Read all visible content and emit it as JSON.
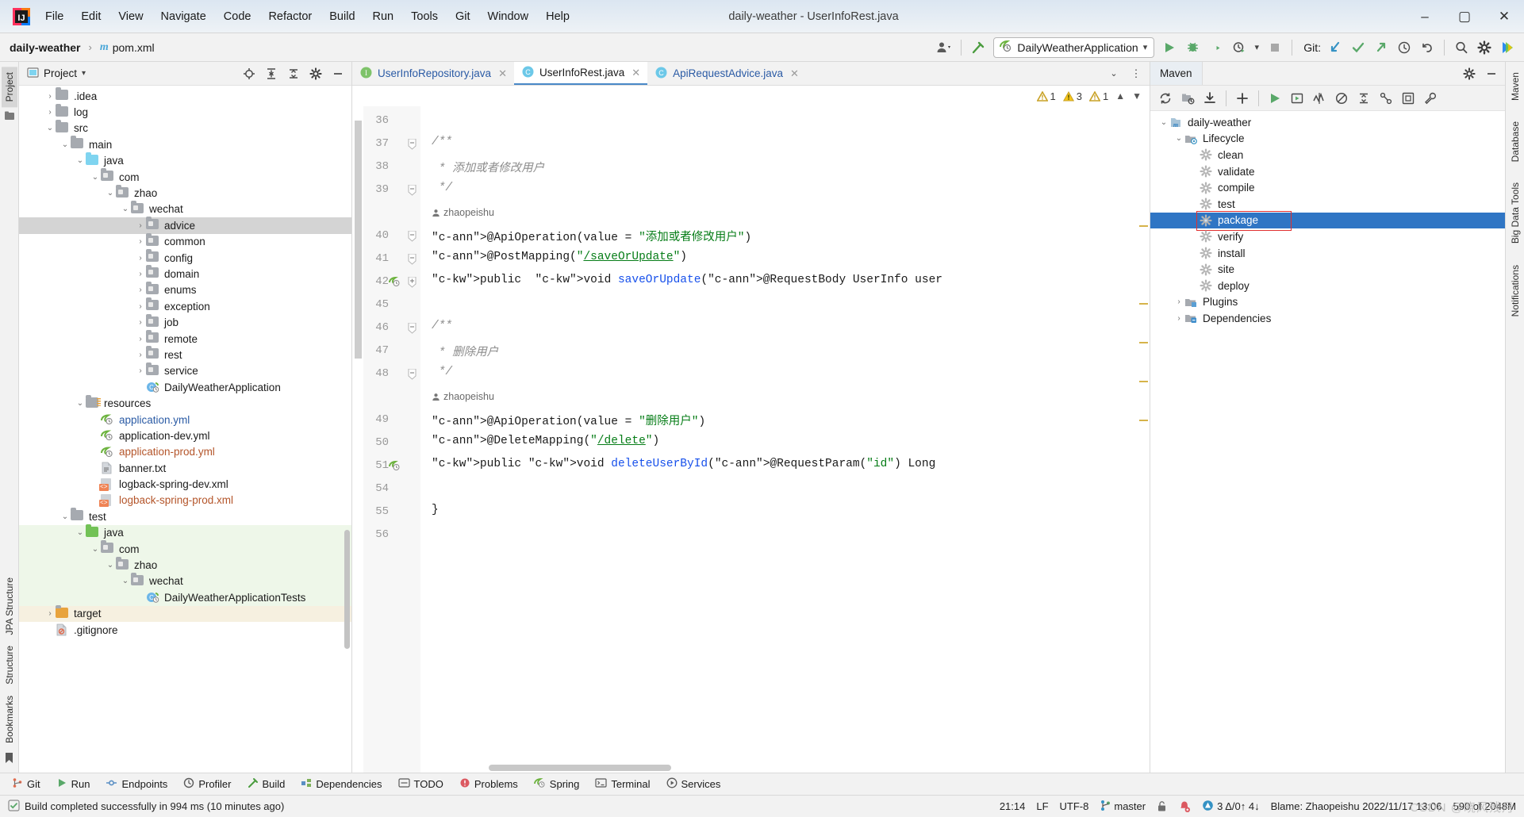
{
  "window": {
    "title": "daily-weather - UserInfoRest.java",
    "minimize": "–",
    "maximize": "▢",
    "close": "✕",
    "logo_icon": "intellij-idea-logo"
  },
  "menubar": {
    "items": [
      "File",
      "Edit",
      "View",
      "Navigate",
      "Code",
      "Refactor",
      "Build",
      "Run",
      "Tools",
      "Git",
      "Window",
      "Help"
    ]
  },
  "navbar": {
    "project": "daily-weather",
    "file": "pom.xml",
    "file_icon": "maven-m-icon",
    "separator": "›",
    "run_config": "DailyWeatherApplication",
    "run_config_icon": "spring-boot-icon",
    "dropdown_caret": "▾",
    "git_label": "Git:",
    "icons": [
      "user-avatar-icon",
      "build-hammer-icon",
      "run-icon",
      "debug-icon",
      "run-coverage-icon",
      "profiler-icon",
      "stop-icon",
      "git-update-icon",
      "git-commit-icon",
      "git-push-icon",
      "git-history-icon",
      "git-rollback-icon",
      "search-everywhere-icon",
      "settings-gear-icon",
      "ide-features-icon"
    ]
  },
  "left_strip": {
    "tabs": [
      {
        "label": "Project",
        "icon": "project-icon",
        "selected": true
      },
      {
        "label": "Bookmarks",
        "icon": "bookmark-icon",
        "selected": false
      },
      {
        "label": "Structure",
        "icon": "structure-icon",
        "selected": false
      },
      {
        "label": "JPA Structure",
        "icon": "jpa-structure-icon",
        "selected": false
      }
    ]
  },
  "right_strip": {
    "tabs": [
      {
        "label": "Maven",
        "icon": "maven-icon"
      },
      {
        "label": "Database",
        "icon": "database-icon"
      },
      {
        "label": "Big Data Tools",
        "icon": "big-data-tools-icon"
      },
      {
        "label": "Notifications",
        "icon": "notifications-icon"
      }
    ]
  },
  "project_pane": {
    "title": "Project",
    "dropdown_caret": "▾",
    "header_icons": [
      "locate-icon",
      "expand-all-icon",
      "collapse-all-icon",
      "options-gear-icon",
      "hide-minus-icon"
    ],
    "tree": [
      {
        "label": ".idea",
        "depth": 1,
        "arrow": "›",
        "icon": "folder",
        "state": "collapsed"
      },
      {
        "label": "log",
        "depth": 1,
        "arrow": "›",
        "icon": "folder",
        "state": "collapsed"
      },
      {
        "label": "src",
        "depth": 1,
        "arrow": "⌄",
        "icon": "folder",
        "state": "expanded"
      },
      {
        "label": "main",
        "depth": 2,
        "arrow": "⌄",
        "icon": "folder",
        "state": "expanded"
      },
      {
        "label": "java",
        "depth": 3,
        "arrow": "⌄",
        "icon": "folder-blue",
        "state": "expanded"
      },
      {
        "label": "com",
        "depth": 4,
        "arrow": "⌄",
        "icon": "folder-pkg",
        "state": "expanded"
      },
      {
        "label": "zhao",
        "depth": 5,
        "arrow": "⌄",
        "icon": "folder-pkg",
        "state": "expanded"
      },
      {
        "label": "wechat",
        "depth": 6,
        "arrow": "⌄",
        "icon": "folder-pkg",
        "state": "expanded"
      },
      {
        "label": "advice",
        "depth": 7,
        "arrow": "›",
        "icon": "folder-pkg",
        "state": "collapsed",
        "selected": true
      },
      {
        "label": "common",
        "depth": 7,
        "arrow": "›",
        "icon": "folder-pkg",
        "state": "collapsed"
      },
      {
        "label": "config",
        "depth": 7,
        "arrow": "›",
        "icon": "folder-pkg",
        "state": "collapsed"
      },
      {
        "label": "domain",
        "depth": 7,
        "arrow": "›",
        "icon": "folder-pkg",
        "state": "collapsed"
      },
      {
        "label": "enums",
        "depth": 7,
        "arrow": "›",
        "icon": "folder-pkg",
        "state": "collapsed"
      },
      {
        "label": "exception",
        "depth": 7,
        "arrow": "›",
        "icon": "folder-pkg",
        "state": "collapsed"
      },
      {
        "label": "job",
        "depth": 7,
        "arrow": "›",
        "icon": "folder-pkg",
        "state": "collapsed"
      },
      {
        "label": "remote",
        "depth": 7,
        "arrow": "›",
        "icon": "folder-pkg",
        "state": "collapsed"
      },
      {
        "label": "rest",
        "depth": 7,
        "arrow": "›",
        "icon": "folder-pkg",
        "state": "collapsed"
      },
      {
        "label": "service",
        "depth": 7,
        "arrow": "›",
        "icon": "folder-pkg",
        "state": "collapsed"
      },
      {
        "label": "DailyWeatherApplication",
        "depth": 7,
        "arrow": "",
        "icon": "spring-class"
      },
      {
        "label": "resources",
        "depth": 3,
        "arrow": "⌄",
        "icon": "folder-res",
        "state": "expanded"
      },
      {
        "label": "application.yml",
        "depth": 4,
        "arrow": "",
        "icon": "spring-yml",
        "color": "blue"
      },
      {
        "label": "application-dev.yml",
        "depth": 4,
        "arrow": "",
        "icon": "spring-yml"
      },
      {
        "label": "application-prod.yml",
        "depth": 4,
        "arrow": "",
        "icon": "spring-yml",
        "color": "orange"
      },
      {
        "label": "banner.txt",
        "depth": 4,
        "arrow": "",
        "icon": "text-file"
      },
      {
        "label": "logback-spring-dev.xml",
        "depth": 4,
        "arrow": "",
        "icon": "xml-file"
      },
      {
        "label": "logback-spring-prod.xml",
        "depth": 4,
        "arrow": "",
        "icon": "xml-file",
        "color": "orange"
      },
      {
        "label": "test",
        "depth": 2,
        "arrow": "⌄",
        "icon": "folder",
        "state": "expanded"
      },
      {
        "label": "java",
        "depth": 3,
        "arrow": "⌄",
        "icon": "folder-green",
        "state": "expanded",
        "scope": "test"
      },
      {
        "label": "com",
        "depth": 4,
        "arrow": "⌄",
        "icon": "folder-pkg",
        "state": "expanded",
        "scope": "test"
      },
      {
        "label": "zhao",
        "depth": 5,
        "arrow": "⌄",
        "icon": "folder-pkg",
        "state": "expanded",
        "scope": "test"
      },
      {
        "label": "wechat",
        "depth": 6,
        "arrow": "⌄",
        "icon": "folder-pkg",
        "state": "expanded",
        "scope": "test"
      },
      {
        "label": "DailyWeatherApplicationTests",
        "depth": 7,
        "arrow": "",
        "icon": "spring-class",
        "scope": "test"
      },
      {
        "label": "target",
        "depth": 1,
        "arrow": "›",
        "icon": "folder-target",
        "state": "collapsed",
        "scope": "target"
      },
      {
        "label": ".gitignore",
        "depth": 1,
        "arrow": "",
        "icon": "gitignore-file"
      }
    ]
  },
  "editor": {
    "tabs": [
      {
        "label": "UserInfoRepository.java",
        "icon": "interface-icon",
        "active": false,
        "close": "✕"
      },
      {
        "label": "UserInfoRest.java",
        "icon": "class-icon",
        "active": true,
        "close": "✕"
      },
      {
        "label": "ApiRequestAdvice.java",
        "icon": "class-icon",
        "active": false,
        "close": "✕"
      }
    ],
    "tab_actions": [
      "tab-list-dropdown-icon",
      "tab-options-icon"
    ],
    "inspections": [
      {
        "icon": "warning-triangle-icon",
        "count": "1",
        "severity": "weak"
      },
      {
        "icon": "warning-triangle-icon",
        "count": "3",
        "severity": "warning"
      },
      {
        "icon": "warning-triangle-icon",
        "count": "1",
        "severity": "weak"
      }
    ],
    "inspection_nav": [
      "▲",
      "▼"
    ],
    "lines": [
      {
        "num": "36",
        "fold": "",
        "text": ""
      },
      {
        "num": "37",
        "fold": "−",
        "text": "/**",
        "cls": "c-com"
      },
      {
        "num": "38",
        "fold": "",
        "text": " * 添加或者修改用户",
        "cls": "c-com"
      },
      {
        "num": "39",
        "fold": "⌃",
        "text": " */",
        "cls": "c-com"
      },
      {
        "num": "",
        "fold": "",
        "author": "zhaopeishu"
      },
      {
        "num": "40",
        "fold": "−",
        "text": "@ApiOperation(value = \"添加或者修改用户\")"
      },
      {
        "num": "41",
        "fold": "⌃",
        "text": "@PostMapping(\"/saveOrUpdate\")"
      },
      {
        "num": "42",
        "fold": "+",
        "text": "public  void saveOrUpdate(@RequestBody UserInfo user",
        "gutter_icon": "spring-endpoint-icon"
      },
      {
        "num": "45",
        "fold": "",
        "text": ""
      },
      {
        "num": "46",
        "fold": "−",
        "text": "/**",
        "cls": "c-com"
      },
      {
        "num": "47",
        "fold": "",
        "text": " * 删除用户",
        "cls": "c-com"
      },
      {
        "num": "48",
        "fold": "⌃",
        "text": " */",
        "cls": "c-com"
      },
      {
        "num": "",
        "fold": "",
        "author": "zhaopeishu"
      },
      {
        "num": "49",
        "fold": "",
        "text": "@ApiOperation(value = \"删除用户\")"
      },
      {
        "num": "50",
        "fold": "",
        "text": "@DeleteMapping(\"/delete\")"
      },
      {
        "num": "51",
        "fold": "",
        "text": "public void deleteUserById(@RequestParam(\"id\") Long",
        "gutter_icon": "spring-endpoint-icon"
      },
      {
        "num": "54",
        "fold": "",
        "text": ""
      },
      {
        "num": "55",
        "fold": "",
        "text": "}"
      },
      {
        "num": "56",
        "fold": "",
        "text": ""
      }
    ]
  },
  "maven_pane": {
    "title": "Maven",
    "header_icons": [
      "settings-gear-icon",
      "hide-minus-icon"
    ],
    "toolbar_icons": [
      "reload-all-icon",
      "generate-sources-icon",
      "download-sources-icon",
      "add-maven-project-icon",
      "run-maven-build-icon",
      "execute-goal-icon",
      "toggle-skip-tests-icon",
      "toggle-offline-icon",
      "collapse-all-icon",
      "show-dependencies-icon",
      "expand-icon",
      "maven-settings-icon"
    ],
    "tree": [
      {
        "label": "daily-weather",
        "depth": 0,
        "arrow": "⌄",
        "icon": "maven-project-icon"
      },
      {
        "label": "Lifecycle",
        "depth": 1,
        "arrow": "⌄",
        "icon": "lifecycle-folder-icon"
      },
      {
        "label": "clean",
        "depth": 2,
        "arrow": "",
        "icon": "goal-gear-icon"
      },
      {
        "label": "validate",
        "depth": 2,
        "arrow": "",
        "icon": "goal-gear-icon"
      },
      {
        "label": "compile",
        "depth": 2,
        "arrow": "",
        "icon": "goal-gear-icon"
      },
      {
        "label": "test",
        "depth": 2,
        "arrow": "",
        "icon": "goal-gear-icon"
      },
      {
        "label": "package",
        "depth": 2,
        "arrow": "",
        "icon": "goal-gear-icon",
        "selected": true,
        "highlighted": true
      },
      {
        "label": "verify",
        "depth": 2,
        "arrow": "",
        "icon": "goal-gear-icon"
      },
      {
        "label": "install",
        "depth": 2,
        "arrow": "",
        "icon": "goal-gear-icon"
      },
      {
        "label": "site",
        "depth": 2,
        "arrow": "",
        "icon": "goal-gear-icon"
      },
      {
        "label": "deploy",
        "depth": 2,
        "arrow": "",
        "icon": "goal-gear-icon"
      },
      {
        "label": "Plugins",
        "depth": 1,
        "arrow": "›",
        "icon": "plugins-folder-icon"
      },
      {
        "label": "Dependencies",
        "depth": 1,
        "arrow": "›",
        "icon": "dependencies-folder-icon"
      }
    ],
    "highlight_color": "#2f75c4",
    "annotation_box_color": "#e03030"
  },
  "tool_window_bar": {
    "items": [
      {
        "label": "Git",
        "icon": "git-icon"
      },
      {
        "label": "Run",
        "icon": "run-icon"
      },
      {
        "label": "Endpoints",
        "icon": "endpoints-icon"
      },
      {
        "label": "Profiler",
        "icon": "profiler-icon"
      },
      {
        "label": "Build",
        "icon": "build-icon"
      },
      {
        "label": "Dependencies",
        "icon": "dependencies-icon"
      },
      {
        "label": "TODO",
        "icon": "todo-icon"
      },
      {
        "label": "Problems",
        "icon": "problems-icon"
      },
      {
        "label": "Spring",
        "icon": "spring-icon"
      },
      {
        "label": "Terminal",
        "icon": "terminal-icon"
      },
      {
        "label": "Services",
        "icon": "services-icon"
      }
    ]
  },
  "statusbar": {
    "message_icon": "inspection-ok-icon",
    "message": "Build completed successfully in 994 ms (10 minutes ago)",
    "time": "21:14",
    "line_separator": "LF",
    "encoding": "UTF-8",
    "branch": "master",
    "branch_icon": "git-branch-icon",
    "lock_icon": "readonly-lock-icon",
    "error_icon": "error-bell-icon",
    "vcs_changes_icon": "vcs-changes-icon",
    "vcs_changes": "3 Δ/0↑ 4↓",
    "blame": "Blame: Zhaopeishu 2022/11/17 13:06",
    "memory": "590 of 2048M",
    "watermark": "CSDN @晓风残月"
  }
}
